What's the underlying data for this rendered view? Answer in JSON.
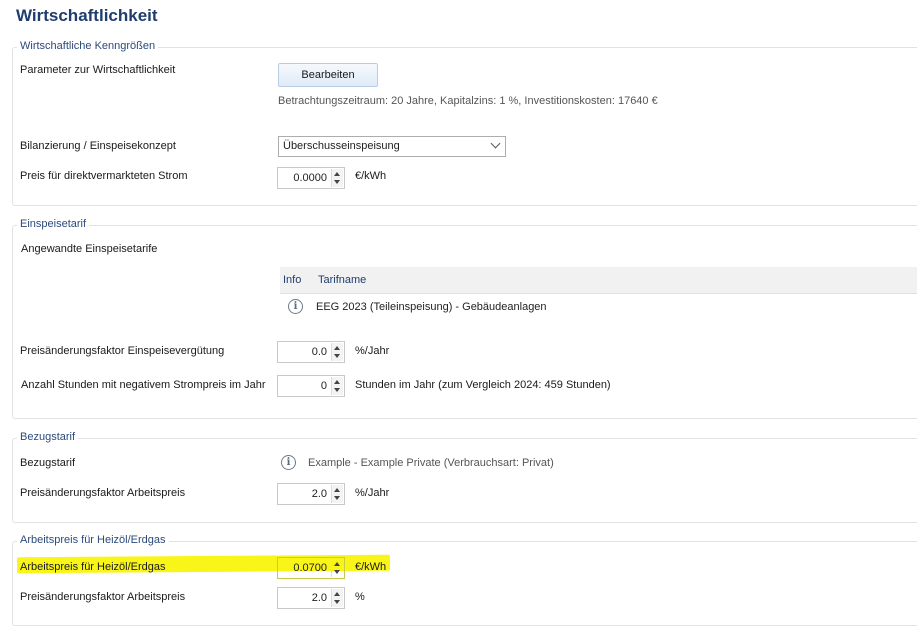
{
  "page_title": "Wirtschaftlichkeit",
  "sections": {
    "kenngroessen": {
      "legend": "Wirtschaftliche Kenngrößen",
      "param_label": "Parameter zur Wirtschaftlichkeit",
      "edit_button": "Bearbeiten",
      "param_summary": "Betrachtungszeitraum: 20 Jahre, Kapitalzins: 1 %, Investitionskosten: 17640 €",
      "bilanz_label": "Bilanzierung / Einspeisekonzept",
      "bilanz_value": "Überschusseinspeisung",
      "preis_label": "Preis für direktvermarkteten Strom",
      "preis_value": "0.0000",
      "preis_unit": "€/kWh"
    },
    "einspeisetarif": {
      "legend": "Einspeisetarif",
      "tarife_label": "Angewandte Einspeisetarife",
      "table_headers": [
        "Info",
        "Tarifname"
      ],
      "table_rows": [
        {
          "info_icon": "info-icon",
          "name": "EEG 2023 (Teileinspeisung) - Gebäudeanlagen"
        }
      ],
      "aenderung_label": "Preisänderungsfaktor Einspeisevergütung",
      "aenderung_value": "0.0",
      "aenderung_unit": "%/Jahr",
      "stunden_label": "Anzahl Stunden mit negativem Strompreis im Jahr",
      "stunden_value": "0",
      "stunden_unit": "Stunden im Jahr (zum Vergleich 2024: 459 Stunden)"
    },
    "bezugstarif": {
      "legend": "Bezugstarif",
      "tarif_label": "Bezugstarif",
      "tarif_value": "Example - Example Private (Verbrauchsart: Privat)",
      "aenderung_label": "Preisänderungsfaktor Arbeitspreis",
      "aenderung_value": "2.0",
      "aenderung_unit": "%/Jahr"
    },
    "heizoel": {
      "legend": "Arbeitspreis für Heizöl/Erdgas",
      "preis_label": "Arbeitspreis für Heizöl/Erdgas",
      "preis_value": "0.0700",
      "preis_unit": "€/kWh",
      "aenderung_label": "Preisänderungsfaktor Arbeitspreis",
      "aenderung_value": "2.0",
      "aenderung_unit": "%"
    }
  },
  "colors": {
    "title": "#1f3d6e",
    "highlight": "#f8f400"
  }
}
